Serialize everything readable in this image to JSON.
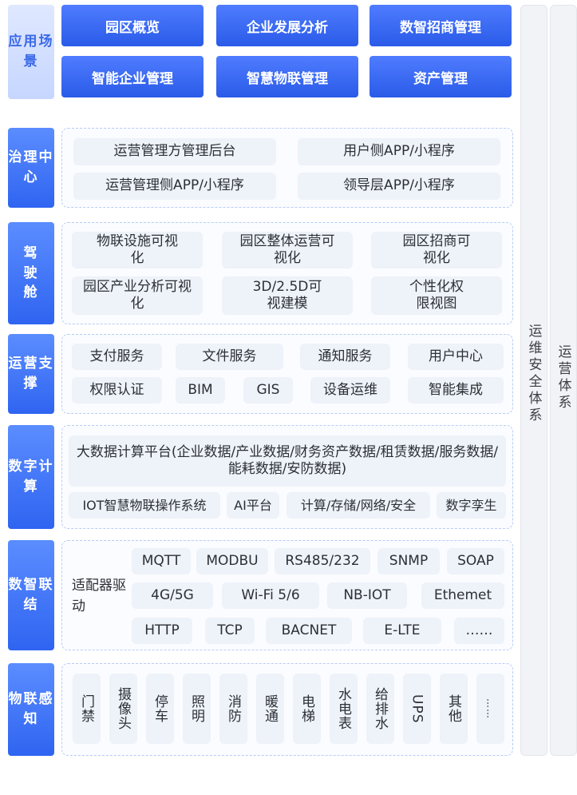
{
  "layers": {
    "application": {
      "label": "应用场景",
      "items": [
        "园区概览",
        "企业发展分析",
        "数智招商管理",
        "智能企业管理",
        "智慧物联管理",
        "资产管理"
      ]
    },
    "governance": {
      "label": "治理中心",
      "items": [
        "运营管理方管理后台",
        "用户侧APP/小程序",
        "运营管理侧APP/小程序",
        "领导层APP/小程序"
      ]
    },
    "cockpit": {
      "label": "驾驶舱",
      "items": [
        "物联设施可视化",
        "园区整体运营可视化",
        "园区招商可视化",
        "园区产业分析可视化",
        "3D/2.5D可视建模",
        "个性化权限视图"
      ]
    },
    "operations": {
      "label": "运营支撑",
      "items": [
        "支付服务",
        "文件服务",
        "通知服务",
        "用户中心",
        "权限认证",
        "BIM",
        "GIS",
        "设备运维",
        "智能集成"
      ]
    },
    "computing": {
      "label": "数字计算",
      "platform": "大数据计算平台(企业数据/产业数据/财务资产数据/租赁数据/服务数据/能耗数据/安防数据)",
      "items": [
        "IOT智慧物联操作系统",
        "AI平台",
        "计算/存储/网络/安全",
        "数字孪生"
      ]
    },
    "connection": {
      "label": "数智联结",
      "adapter": "适配器驱 动",
      "items": [
        "MQTT",
        "MODBU",
        "RS485/232",
        "SNMP",
        "SOAP",
        "4G/5G",
        "Wi-Fi 5/6",
        "NB-IOT",
        "Ethemet",
        "HTTP",
        "TCP",
        "BACNET",
        "E-LTE",
        "……"
      ]
    },
    "sensing": {
      "label": "物联感知",
      "items": [
        "门禁",
        "摄像头",
        "停车",
        "照明",
        "消防",
        "暖通",
        "电梯",
        "水电表",
        "给排水",
        "UPS",
        "其他",
        "……"
      ]
    }
  },
  "sidebars": {
    "security": "运维安全体系",
    "ops": "运营体系"
  }
}
